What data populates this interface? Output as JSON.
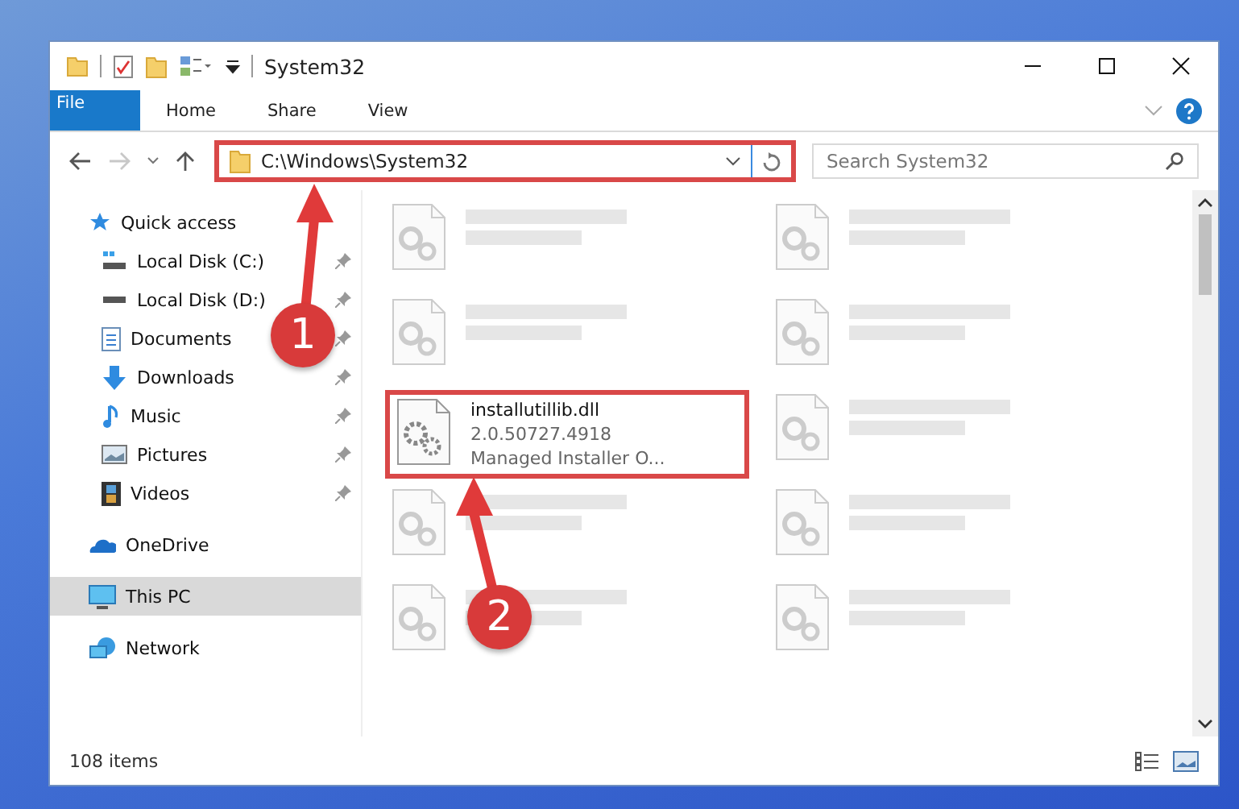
{
  "window": {
    "title": "System32"
  },
  "ribbon_tabs": [
    {
      "label": "File",
      "kind": "file"
    },
    {
      "label": "Home",
      "kind": "tab"
    },
    {
      "label": "Share",
      "kind": "tab"
    },
    {
      "label": "View",
      "kind": "tab"
    }
  ],
  "address": {
    "path": "C:\\Windows\\System32",
    "highlighted": true
  },
  "search": {
    "placeholder": "Search System32"
  },
  "sidebar": {
    "items": [
      {
        "label": "Quick access",
        "selected": false,
        "children": [
          {
            "label": "Local Disk (C:)",
            "pinned": true,
            "selected": false
          },
          {
            "label": "Local Disk (D:)",
            "pinned": true,
            "selected": false
          },
          {
            "label": "Documents",
            "pinned": true,
            "selected": false
          },
          {
            "label": "Downloads",
            "pinned": true,
            "selected": false
          },
          {
            "label": "Music",
            "pinned": true,
            "selected": false
          },
          {
            "label": "Pictures",
            "pinned": true,
            "selected": false
          },
          {
            "label": "Videos",
            "pinned": true,
            "selected": false
          }
        ]
      },
      {
        "label": "OneDrive",
        "selected": false
      },
      {
        "label": "This PC",
        "selected": true
      },
      {
        "label": "Network",
        "selected": false
      }
    ]
  },
  "files": [
    {
      "kind": "blurred"
    },
    {
      "kind": "blurred"
    },
    {
      "kind": "blurred"
    },
    {
      "kind": "blurred"
    },
    {
      "kind": "file",
      "name": "installutillib.dll",
      "line_2": "2.0.50727.4918",
      "line_3": "Managed Installer O...",
      "highlighted": true
    },
    {
      "kind": "blurred"
    },
    {
      "kind": "blurred"
    },
    {
      "kind": "blurred"
    },
    {
      "kind": "blurred"
    },
    {
      "kind": "blurred"
    }
  ],
  "status_bar": {
    "count": "108 items"
  },
  "annotations": [
    {
      "number": "1"
    },
    {
      "number": "2"
    }
  ]
}
